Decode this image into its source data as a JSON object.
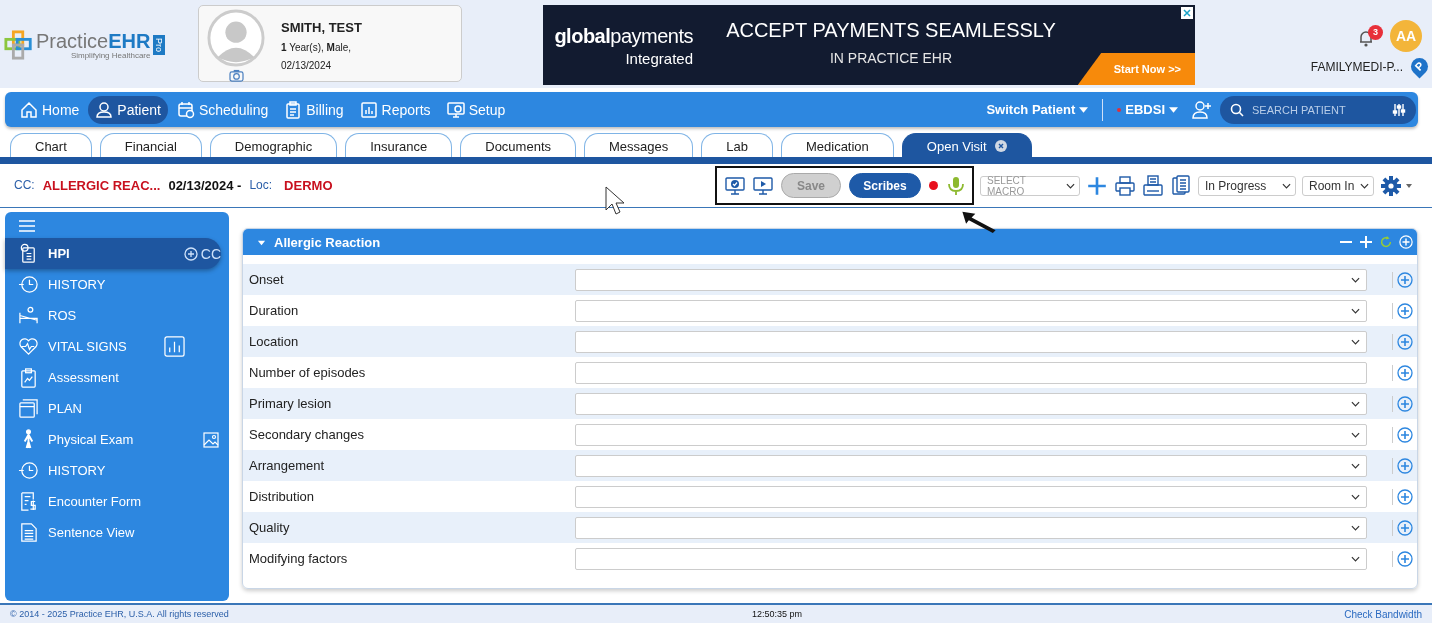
{
  "logo": {
    "name": "Practice",
    "name_strong": "EHR",
    "tagline": "Simplifying Healthcare",
    "edition": "Pro"
  },
  "patient": {
    "name": "SMITH, TEST",
    "age_sex": "**1** Year(s), **M**ale,",
    "dob": "02/13/2024"
  },
  "ad": {
    "brand": "**global**payments",
    "brand_sub": "Integrated",
    "headline": "ACCEPT PAYMENTS SEAMLESSLY",
    "subline": "IN PRACTICE EHR",
    "cta": "Start Now >>"
  },
  "user": {
    "notifications": "3",
    "initials": "AA",
    "practice": "FAMILYMEDI-P...",
    "location_badge": "P"
  },
  "nav": [
    {
      "label": "Home",
      "selected": false
    },
    {
      "label": "Patient",
      "selected": true
    },
    {
      "label": "Scheduling",
      "selected": false
    },
    {
      "label": "Billing",
      "selected": false
    },
    {
      "label": "Reports",
      "selected": false
    },
    {
      "label": "Setup",
      "selected": false
    }
  ],
  "nav_right": {
    "switch_patient": "Switch Patient",
    "provider": "EBDSI",
    "search": {
      "placeholder": "SEARCH PATIENT"
    }
  },
  "tabs": [
    {
      "label": "Chart",
      "selected": false,
      "closable": false
    },
    {
      "label": "Financial",
      "selected": false,
      "closable": false
    },
    {
      "label": "Demographic",
      "selected": false,
      "closable": false
    },
    {
      "label": "Insurance",
      "selected": false,
      "closable": false
    },
    {
      "label": "Documents",
      "selected": false,
      "closable": false
    },
    {
      "label": "Messages",
      "selected": false,
      "closable": false
    },
    {
      "label": "Lab",
      "selected": false,
      "closable": false
    },
    {
      "label": "Medication",
      "selected": false,
      "closable": false
    },
    {
      "label": "Open Visit",
      "selected": true,
      "closable": true
    }
  ],
  "visit": {
    "cc_label": "CC:",
    "cc": "ALLERGIC REAC...",
    "date": "02/13/2024 -",
    "loc_label": "Loc:",
    "loc": "DERMO"
  },
  "toolbar": {
    "save": {
      "label": "Save",
      "disabled": true
    },
    "scribes": {
      "label": "Scribes",
      "disabled": false
    },
    "recording": true,
    "macro": {
      "placeholder": "SELECT MACRO"
    },
    "status": "In Progress",
    "room": "Room In"
  },
  "sidebar": [
    {
      "label": "HPI",
      "selected": true,
      "accessory_text": "CC"
    },
    {
      "label": "HISTORY",
      "selected": false
    },
    {
      "label": "ROS",
      "selected": false
    },
    {
      "label": "VITAL SIGNS",
      "selected": false
    },
    {
      "label": "Assessment",
      "selected": false
    },
    {
      "label": "PLAN",
      "selected": false
    },
    {
      "label": "Physical Exam",
      "selected": false
    },
    {
      "label": "HISTORY",
      "selected": false
    },
    {
      "label": "Encounter Form",
      "selected": false
    },
    {
      "label": "Sentence View",
      "selected": false
    }
  ],
  "panel": {
    "title": "Allergic Reaction",
    "expanded": true,
    "fields": [
      {
        "label": "Onset",
        "kind": "dropdown"
      },
      {
        "label": "Duration",
        "kind": "dropdown"
      },
      {
        "label": "Location",
        "kind": "dropdown"
      },
      {
        "label": "Number of episodes",
        "kind": "text"
      },
      {
        "label": "Primary lesion",
        "kind": "dropdown"
      },
      {
        "label": "Secondary changes",
        "kind": "dropdown"
      },
      {
        "label": "Arrangement",
        "kind": "dropdown"
      },
      {
        "label": "Distribution",
        "kind": "dropdown"
      },
      {
        "label": "Quality",
        "kind": "dropdown"
      },
      {
        "label": "Modifying factors",
        "kind": "dropdown"
      }
    ]
  },
  "footer": {
    "copyright": "© 2014 - 2025 Practice EHR, U.S.A. All rights reserved",
    "time": "12:50:35 pm",
    "link": "Check Bandwidth"
  }
}
